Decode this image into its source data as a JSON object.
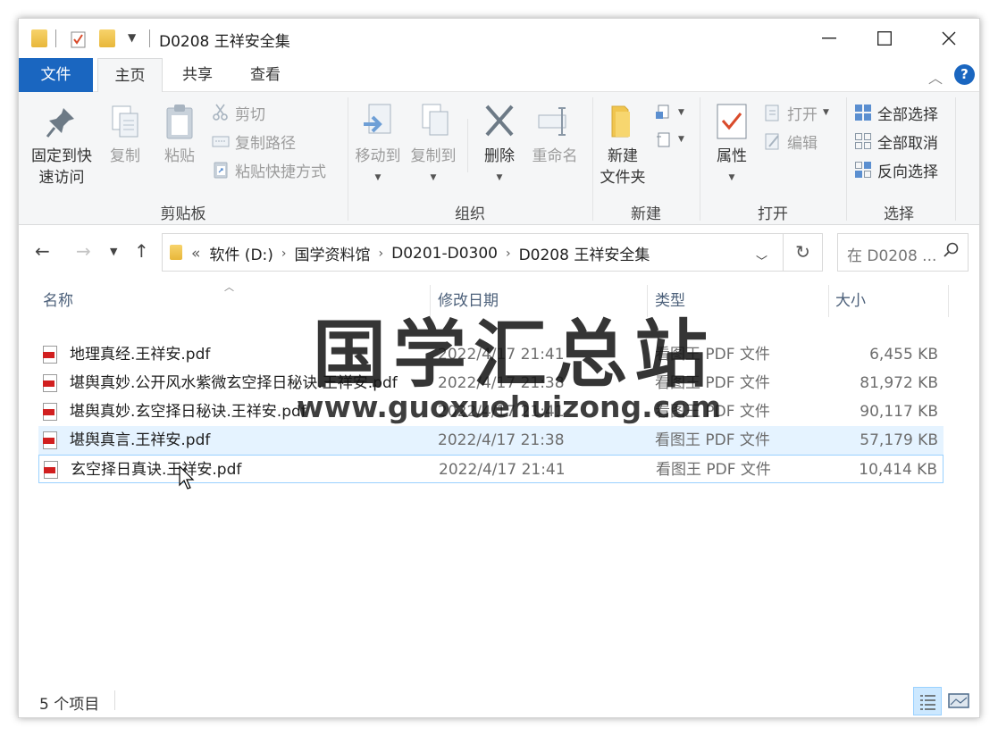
{
  "window": {
    "title": "D0208 王祥安全集"
  },
  "window_controls": {
    "minimize": "—",
    "maximize": "☐",
    "close": "✕"
  },
  "ribbon_tabs": {
    "file": "文件",
    "home": "主页",
    "share": "共享",
    "view": "查看",
    "help": "?"
  },
  "ribbon": {
    "clipboard": {
      "label": "剪贴板",
      "pin": "固定到快\n速访问",
      "pin_line1": "固定到快",
      "pin_line2": "速访问",
      "copy": "复制",
      "paste": "粘贴",
      "cut": "剪切",
      "copy_path": "复制路径",
      "paste_shortcut": "粘贴快捷方式"
    },
    "organize": {
      "label": "组织",
      "move_to": "移动到",
      "copy_to": "复制到",
      "delete": "删除",
      "rename": "重命名"
    },
    "new": {
      "label": "新建",
      "new_folder_line1": "新建",
      "new_folder_line2": "文件夹"
    },
    "open": {
      "label": "打开",
      "properties": "属性",
      "open": "打开",
      "edit": "编辑"
    },
    "select": {
      "label": "选择",
      "select_all": "全部选择",
      "select_none": "全部取消",
      "invert": "反向选择"
    }
  },
  "address": {
    "overflow": "«",
    "crumbs": [
      "软件 (D:)",
      "国学资料馆",
      "D0201-D0300",
      "D0208 王祥安全集"
    ],
    "search_placeholder": "在 D0208 ..."
  },
  "columns": {
    "name": "名称",
    "modified": "修改日期",
    "type": "类型",
    "size": "大小"
  },
  "files": [
    {
      "name": "地理真经.王祥安.pdf",
      "modified": "2022/4/17 21:41",
      "type": "看图王 PDF 文件",
      "size": "6,455 KB"
    },
    {
      "name": "堪舆真妙.公开风水紫微玄空择日秘诀.王祥安.pdf",
      "modified": "2022/4/17 21:38",
      "type": "看图王 PDF 文件",
      "size": "81,972 KB"
    },
    {
      "name": "堪舆真妙.玄空择日秘诀.王祥安.pdf",
      "modified": "2022/4/17 21:41",
      "type": "看图王 PDF 文件",
      "size": "90,117 KB"
    },
    {
      "name": "堪舆真言.王祥安.pdf",
      "modified": "2022/4/17 21:38",
      "type": "看图王 PDF 文件",
      "size": "57,179 KB"
    },
    {
      "name": "玄空择日真诀.王祥安.pdf",
      "modified": "2022/4/17 21:41",
      "type": "看图王 PDF 文件",
      "size": "10,414 KB"
    }
  ],
  "status": {
    "count": "5 个项目"
  },
  "watermark": {
    "title": "国学汇总站",
    "url": "www.guoxuehuizong.com"
  },
  "colors": {
    "accent": "#1a66c0",
    "hover_row": "#e5f3ff",
    "focus_border": "#99d1ff",
    "pdf_red": "#d11f1f",
    "folder_yellow": "#f0c54f"
  }
}
